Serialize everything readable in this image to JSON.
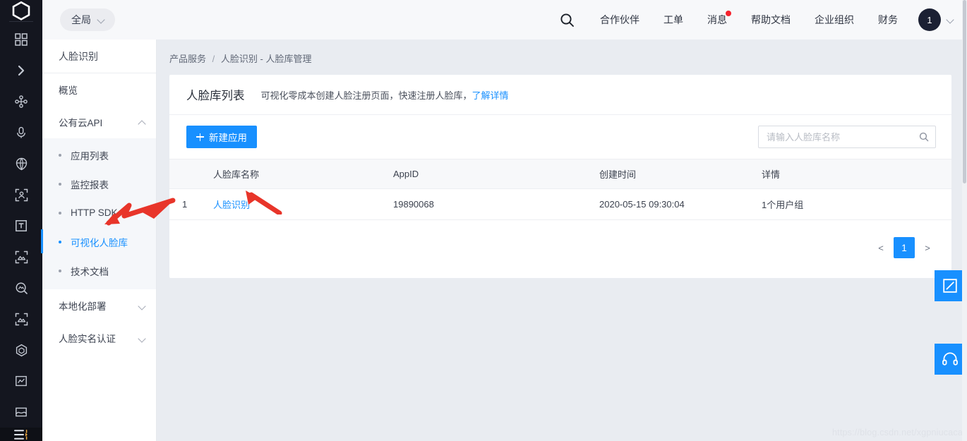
{
  "header": {
    "scope_label": "全局",
    "search_icon": "search-icon",
    "nav": [
      {
        "label": "合作伙伴",
        "badge": false
      },
      {
        "label": "工单",
        "badge": false
      },
      {
        "label": "消息",
        "badge": true
      },
      {
        "label": "帮助文档",
        "badge": false
      },
      {
        "label": "企业组织",
        "badge": false
      },
      {
        "label": "财务",
        "badge": false
      }
    ],
    "avatar_text": "1"
  },
  "rail": {
    "logo_icon": "cube-logo-icon",
    "items": [
      {
        "icon": "dashboard-grid-icon"
      },
      {
        "icon": "chevron-right-icon"
      },
      {
        "icon": "node-network-icon"
      },
      {
        "icon": "microphone-icon"
      },
      {
        "icon": "globe-shield-icon"
      },
      {
        "icon": "face-detect-icon"
      },
      {
        "icon": "text-box-icon"
      },
      {
        "icon": "image-scan-icon"
      },
      {
        "icon": "image-search-icon"
      },
      {
        "icon": "image-scan-2-icon"
      },
      {
        "icon": "cube-icon"
      },
      {
        "icon": "chart-box-icon"
      },
      {
        "icon": "image-frame-icon"
      }
    ],
    "bottom_icon": "collapse-menu-icon"
  },
  "sidebar": {
    "title": "人脸识别",
    "overview": "概览",
    "group": {
      "label": "公有云API",
      "expanded": true,
      "items": [
        {
          "label": "应用列表",
          "active": false
        },
        {
          "label": "监控报表",
          "active": false
        },
        {
          "label": "HTTP SDK",
          "active": false
        },
        {
          "label": "可视化人脸库",
          "active": true
        },
        {
          "label": "技术文档",
          "active": false
        }
      ]
    },
    "collapsed_groups": [
      {
        "label": "本地化部署"
      },
      {
        "label": "人脸实名认证"
      }
    ]
  },
  "main": {
    "breadcrumb": {
      "root": "产品服务",
      "sep": "/",
      "current": "人脸识别 - 人脸库管理"
    },
    "card": {
      "title": "人脸库列表",
      "desc": "可视化零成本创建人脸注册页面，快速注册人脸库，",
      "desc_link": "了解详情"
    },
    "toolbar": {
      "create_label": "新建应用",
      "search_placeholder": "请输入人脸库名称",
      "search_value": "",
      "search_icon": "search-icon"
    },
    "table": {
      "columns": [
        "",
        "人脸库名称",
        "AppID",
        "创建时间",
        "详情"
      ],
      "rows": [
        {
          "index": "1",
          "name": "人脸识别",
          "appid": "19890068",
          "created": "2020-05-15 09:30:04",
          "detail": "1个用户组"
        }
      ]
    },
    "pagination": {
      "prev": "<",
      "current": "1",
      "next": ">"
    }
  },
  "floating": {
    "edit_icon": "edit-feedback-icon",
    "support_icon": "headset-support-icon"
  },
  "annotations": {
    "arrow_sidebar": "red-arrow-pointing-to-visual-face-library",
    "arrow_table": "red-arrow-pointing-to-face-recognition-link",
    "arrow_color": "#e8352a"
  },
  "watermark": "https://blog.csdn.net/xgpniucaca",
  "colors": {
    "primary": "#1890ff",
    "rail_bg": "#14161f",
    "page_bg": "#e9ecf1",
    "badge_red": "#f5222d"
  }
}
